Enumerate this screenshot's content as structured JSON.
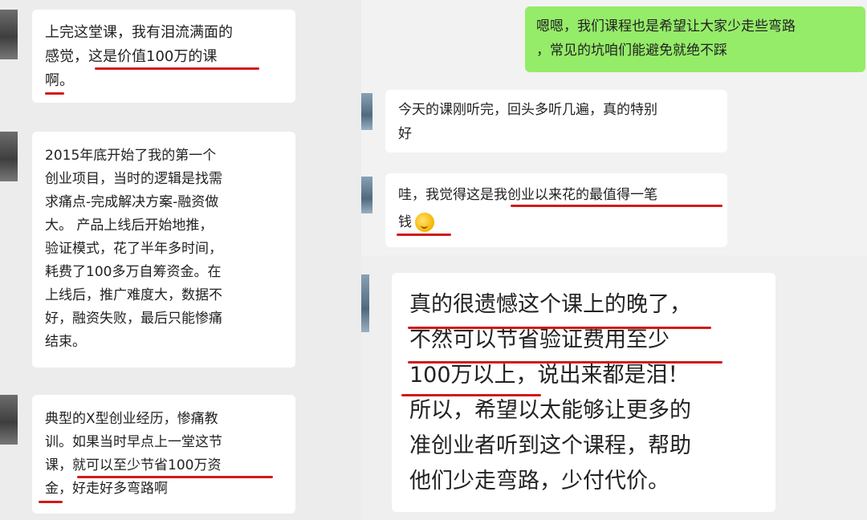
{
  "colors": {
    "left_bg": "#ececec",
    "right_top_bg": "#f2f2f2",
    "right_bottom_bg": "#efefef",
    "own_bubble": "#95ec69",
    "underline": "#d21a1a"
  },
  "left": {
    "msg1": "上完这堂课，我有泪流满面的\n感觉，这是价值100万的课\n啊。",
    "msg2": "2015年底开始了我的第一个\n创业项目，当时的逻辑是找需\n求痛点-完成解决方案-融资做\n大。 产品上线后开始地推，\n验证模式，花了半年多时间，\n耗费了100多万自筹资金。在\n上线后，推广难度大，数据不\n好，融资失败，最后只能惨痛\n结束。",
    "msg3": "典型的X型创业经历，惨痛教\n训。如果当时早点上一堂这节\n课，就可以至少节省100万资\n金，好走好多弯路啊"
  },
  "right_top": {
    "own_msg": "嗯嗯，我们课程也是希望让大家少走些弯路\n，常见的坑咱们能避免就绝不踩",
    "msg1": "今天的课刚听完，回头多听几遍，真的特别\n好",
    "msg2_line1": "哇，我觉得这是我创业以来花的最值得一笔",
    "msg2_line2": "钱",
    "emoji_icon": "face-with-hand-over-mouth"
  },
  "right_bottom": {
    "msg": "真的很遗憾这个课上的晚了，\n不然可以节省验证费用至少\n100万以上，说出来都是泪！\n所以，希望以太能够让更多的\n准创业者听到这个课程，帮助\n他们少走弯路，少付代价。"
  }
}
